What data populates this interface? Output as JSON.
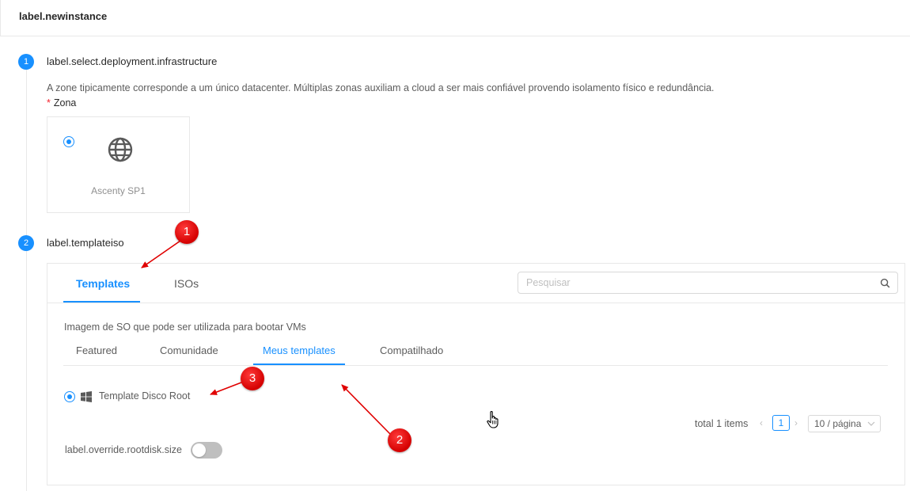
{
  "header": {
    "title": "label.newinstance"
  },
  "steps": [
    {
      "number": "1",
      "title": "label.select.deployment.infrastructure"
    },
    {
      "number": "2",
      "title": "label.templateiso"
    }
  ],
  "zone_section": {
    "description": "A zone tipicamente corresponde a um único datacenter. Múltiplas zonas auxiliam a cloud a ser mais confiável provendo isolamento físico e redundância.",
    "required_mark": "*",
    "field_label": "Zona",
    "zone": {
      "name": "Ascenty SP1",
      "icon": "globe-icon",
      "selected": true
    }
  },
  "template_section": {
    "tabs": [
      {
        "label": "Templates",
        "active": true
      },
      {
        "label": "ISOs",
        "active": false
      }
    ],
    "search": {
      "placeholder": "Pesquisar",
      "value": ""
    },
    "description": "Imagem de SO que pode ser utilizada para bootar VMs",
    "sub_tabs": [
      {
        "label": "Featured",
        "active": false
      },
      {
        "label": "Comunidade",
        "active": false
      },
      {
        "label": "Meus templates",
        "active": true
      },
      {
        "label": "Compatilhado",
        "active": false
      }
    ],
    "templates": [
      {
        "name": "Template Disco Root",
        "os_icon": "windows-icon",
        "selected": true
      }
    ],
    "pagination": {
      "total": "total 1 items",
      "current_page": "1",
      "page_size": "10 / página"
    },
    "override": {
      "label": "label.override.rootdisk.size",
      "enabled": false
    }
  },
  "annotations": [
    {
      "number": "1"
    },
    {
      "number": "2"
    },
    {
      "number": "3"
    }
  ],
  "colors": {
    "primary": "#1890ff",
    "annotation": "#e00000",
    "border": "#e8e8e8"
  }
}
